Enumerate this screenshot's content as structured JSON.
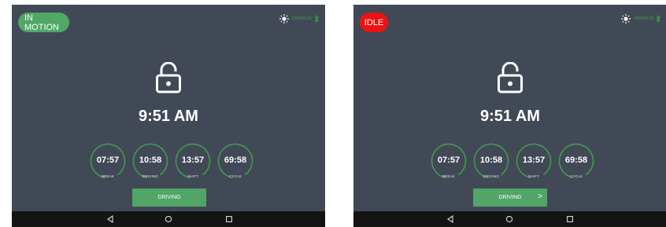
{
  "screens": [
    {
      "status": "IN MOTION",
      "status_color": "#4fa866",
      "serial": "16600U5",
      "time": "9:51 AM",
      "dials": [
        {
          "value": "07:57",
          "label": "BREAK"
        },
        {
          "value": "10:58",
          "label": "DRIVING"
        },
        {
          "value": "13:57",
          "label": "SHIFT"
        },
        {
          "value": "69:58",
          "label": "CYCLE"
        }
      ],
      "button_label": "DRIVING"
    },
    {
      "status": "IDLE",
      "status_color": "#ee1111",
      "serial": "16600U5",
      "time": "9:51 AM",
      "dials": [
        {
          "value": "07:57",
          "label": "BREAK"
        },
        {
          "value": "10:58",
          "label": "DRIVING"
        },
        {
          "value": "13:57",
          "label": "SHIFT"
        },
        {
          "value": "69:58",
          "label": "CYCLE"
        }
      ],
      "button_label": "DRIVING",
      "button_chevron": ">"
    }
  ],
  "icons": {
    "brightness": "sun-icon",
    "bluetooth": "bluetooth-icon",
    "lock": "unlocked-padlock-icon",
    "nav_back": "triangle-back-icon",
    "nav_home": "circle-home-icon",
    "nav_recents": "square-recents-icon"
  },
  "colors": {
    "background": "#424956",
    "accent_green": "#51a566",
    "dial_ring": "#3f9c4c",
    "idle_red": "#ee1111",
    "navbar": "#141414"
  }
}
